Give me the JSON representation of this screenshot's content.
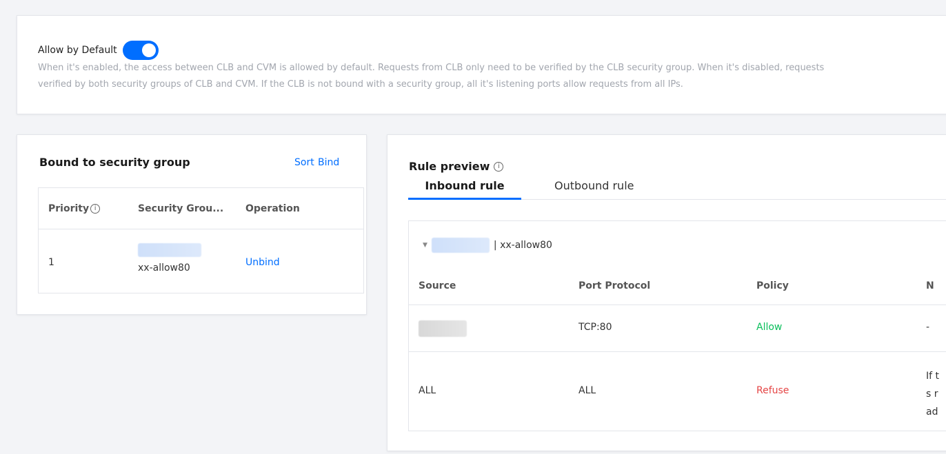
{
  "allow_default": {
    "label": "Allow by Default",
    "enabled": true,
    "description_line1": "When it's enabled, the access between CLB and CVM is allowed by default. Requests from CLB only need to be verified by the CLB security group. When it's disabled, requests",
    "description_line2": "verified by both security groups of CLB and CVM. If the CLB is not bound with a security group, all it's listening ports allow requests from all IPs."
  },
  "bound_panel": {
    "title": "Bound to security group",
    "sort_label": "Sort",
    "bind_label": "Bind",
    "columns": {
      "priority": "Priority",
      "security_group": "Security Grou...",
      "operation": "Operation"
    },
    "rows": [
      {
        "priority": "1",
        "sg_name": "xx-allow80",
        "operation": "Unbind"
      }
    ]
  },
  "rule_preview": {
    "title": "Rule preview",
    "tabs": [
      "Inbound rule",
      "Outbound rule"
    ],
    "active_tab": "Inbound rule",
    "group_label": "| xx-allow80",
    "columns": {
      "source": "Source",
      "port_protocol": "Port Protocol",
      "policy": "Policy",
      "notes": "N"
    },
    "rows": [
      {
        "source": "",
        "port_protocol": "TCP:80",
        "policy": "Allow",
        "notes": "-"
      },
      {
        "source": "ALL",
        "port_protocol": "ALL",
        "policy": "Refuse",
        "notes_l1": "If t",
        "notes_l2": "s r",
        "notes_l3": "ad"
      }
    ]
  },
  "colors": {
    "accent": "#006eff",
    "allow": "#0abf5b",
    "refuse": "#e54545"
  }
}
